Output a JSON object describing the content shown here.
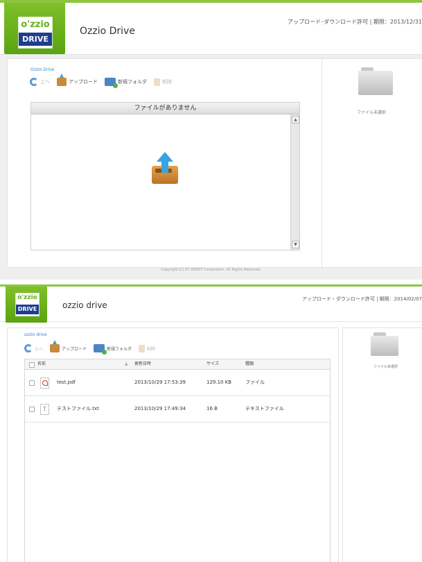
{
  "top": {
    "logo": {
      "line1": "o'zzio",
      "line2": "DRIVE"
    },
    "app_title": "Ozzio Drive",
    "permission_text": "アップロード･ダウンロード許可 | 期限：2013/12/31",
    "breadcrumb": "Ozzio Drive",
    "toolbar": {
      "up": "上へ",
      "upload": "アップロード",
      "new_folder": "新規フォルダ",
      "delete": "削除"
    },
    "list_header": "ファイルがありません",
    "scroll_up": "▲",
    "scroll_down": "▼",
    "side_label": "ファイル未選択",
    "copyright": "Copyright (C) PC DEPOT Corporation. All Rights Reserved."
  },
  "bottom": {
    "logo": {
      "line1": "o'zzio",
      "line2": "DRIVE"
    },
    "app_title": "ozzio drive",
    "permission_text": "アップロード・ダウンロード許可 | 期限：2014/02/07",
    "breadcrumb": "ozzio drive",
    "toolbar": {
      "up": "上へ",
      "upload": "アップロード",
      "new_folder": "新規フォルダ",
      "delete": "削除"
    },
    "columns": {
      "name": "名前",
      "sort_arrow": "▲",
      "updated": "更新日時",
      "size": "サイズ",
      "type": "種類"
    },
    "files": [
      {
        "name": "test.pdf",
        "updated": "2013/10/29 17:53:39",
        "size": "129.10 KB",
        "type": "ファイル",
        "icon": "pdf-file-icon"
      },
      {
        "name": "テストファイル.txt",
        "updated": "2013/10/29 17:49:34",
        "size": "16 B",
        "type": "テキストファイル",
        "icon": "text-file-icon"
      }
    ],
    "side_label": "ファイル未選択"
  },
  "colors": {
    "brand_green": "#8cc63f",
    "logo_blue": "#1f3d8f",
    "link_blue": "#3a7bd5",
    "upload_arrow": "#37a3e3"
  }
}
